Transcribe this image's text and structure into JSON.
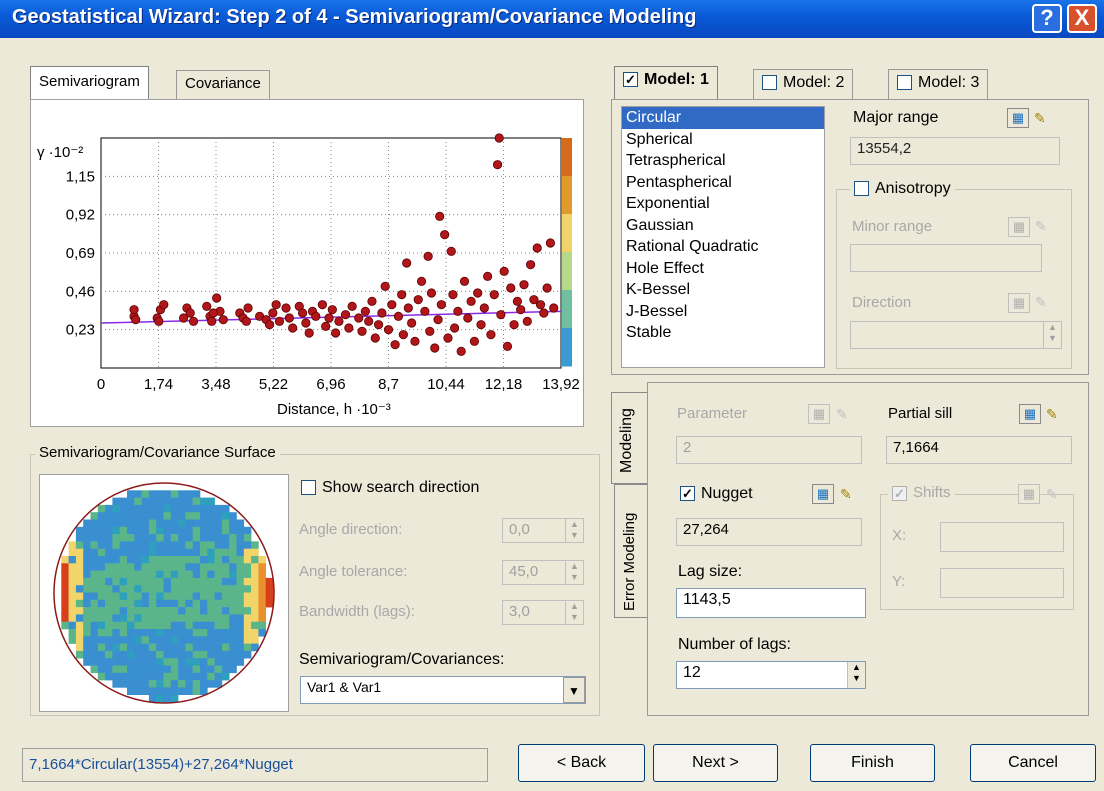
{
  "window": {
    "title": "Geostatistical Wizard: Step 2 of 4 - Semivariogram/Covariance Modeling",
    "help_label": "?",
    "close_label": "X"
  },
  "left_tabs": [
    "Semivariogram",
    "Covariance"
  ],
  "chart_data": {
    "type": "scatter",
    "ylabel": "γ ·10⁻²",
    "xlabel": "Distance, h ·10⁻³",
    "x_ticks": [
      "0",
      "1,74",
      "3,48",
      "5,22",
      "6,96",
      "8,7",
      "10,44",
      "12,18",
      "13,92"
    ],
    "y_ticks": [
      "0,23",
      "0,46",
      "0,69",
      "0,92",
      "1,15"
    ],
    "xlim": [
      0,
      13.92
    ],
    "ylim": [
      0,
      1.38
    ],
    "model_line": {
      "x": [
        0,
        13.92
      ],
      "y": [
        0.27,
        0.34
      ]
    },
    "legend_colors": [
      "#d46a1a",
      "#e39a2d",
      "#f2d36a",
      "#b7d98a",
      "#6fbfa0",
      "#3a9ad4"
    ],
    "points": [
      [
        1.0,
        0.31
      ],
      [
        1.0,
        0.35
      ],
      [
        1.05,
        0.29
      ],
      [
        1.7,
        0.3
      ],
      [
        1.8,
        0.35
      ],
      [
        1.9,
        0.38
      ],
      [
        1.75,
        0.28
      ],
      [
        2.5,
        0.3
      ],
      [
        2.6,
        0.36
      ],
      [
        2.7,
        0.33
      ],
      [
        2.8,
        0.28
      ],
      [
        3.2,
        0.37
      ],
      [
        3.3,
        0.31
      ],
      [
        3.35,
        0.28
      ],
      [
        3.5,
        0.42
      ],
      [
        3.6,
        0.34
      ],
      [
        3.7,
        0.29
      ],
      [
        3.4,
        0.33
      ],
      [
        4.2,
        0.33
      ],
      [
        4.3,
        0.3
      ],
      [
        4.4,
        0.28
      ],
      [
        4.45,
        0.36
      ],
      [
        4.8,
        0.31
      ],
      [
        5.0,
        0.29
      ],
      [
        5.1,
        0.26
      ],
      [
        5.2,
        0.33
      ],
      [
        5.3,
        0.38
      ],
      [
        5.4,
        0.28
      ],
      [
        5.6,
        0.36
      ],
      [
        5.7,
        0.3
      ],
      [
        5.8,
        0.24
      ],
      [
        6.0,
        0.37
      ],
      [
        6.1,
        0.33
      ],
      [
        6.2,
        0.27
      ],
      [
        6.3,
        0.21
      ],
      [
        6.4,
        0.34
      ],
      [
        6.5,
        0.31
      ],
      [
        6.7,
        0.38
      ],
      [
        6.8,
        0.25
      ],
      [
        6.9,
        0.3
      ],
      [
        7.0,
        0.35
      ],
      [
        7.1,
        0.21
      ],
      [
        7.2,
        0.28
      ],
      [
        7.4,
        0.32
      ],
      [
        7.5,
        0.24
      ],
      [
        7.6,
        0.37
      ],
      [
        7.8,
        0.3
      ],
      [
        7.9,
        0.22
      ],
      [
        8.0,
        0.34
      ],
      [
        8.1,
        0.28
      ],
      [
        8.2,
        0.4
      ],
      [
        8.3,
        0.18
      ],
      [
        8.4,
        0.26
      ],
      [
        8.5,
        0.33
      ],
      [
        8.6,
        0.49
      ],
      [
        8.7,
        0.23
      ],
      [
        8.8,
        0.38
      ],
      [
        8.9,
        0.14
      ],
      [
        9.0,
        0.31
      ],
      [
        9.1,
        0.44
      ],
      [
        9.15,
        0.2
      ],
      [
        9.25,
        0.63
      ],
      [
        9.3,
        0.36
      ],
      [
        9.4,
        0.27
      ],
      [
        9.5,
        0.16
      ],
      [
        9.6,
        0.41
      ],
      [
        9.7,
        0.52
      ],
      [
        9.8,
        0.34
      ],
      [
        9.9,
        0.67
      ],
      [
        9.95,
        0.22
      ],
      [
        10.0,
        0.45
      ],
      [
        10.1,
        0.12
      ],
      [
        10.2,
        0.29
      ],
      [
        10.25,
        0.91
      ],
      [
        10.3,
        0.38
      ],
      [
        10.4,
        0.8
      ],
      [
        10.5,
        0.18
      ],
      [
        10.6,
        0.7
      ],
      [
        10.65,
        0.44
      ],
      [
        10.7,
        0.24
      ],
      [
        10.8,
        0.34
      ],
      [
        10.9,
        0.1
      ],
      [
        11.0,
        0.52
      ],
      [
        11.1,
        0.3
      ],
      [
        11.2,
        0.4
      ],
      [
        11.3,
        0.16
      ],
      [
        11.4,
        0.45
      ],
      [
        11.5,
        0.26
      ],
      [
        11.6,
        0.36
      ],
      [
        11.7,
        0.55
      ],
      [
        11.8,
        0.2
      ],
      [
        11.9,
        0.44
      ],
      [
        12.0,
        1.22
      ],
      [
        12.05,
        1.38
      ],
      [
        12.1,
        0.32
      ],
      [
        12.2,
        0.58
      ],
      [
        12.3,
        0.13
      ],
      [
        12.4,
        0.48
      ],
      [
        12.5,
        0.26
      ],
      [
        12.6,
        0.4
      ],
      [
        12.7,
        0.35
      ],
      [
        12.8,
        0.5
      ],
      [
        12.9,
        0.28
      ],
      [
        13.0,
        0.62
      ],
      [
        13.1,
        0.41
      ],
      [
        13.2,
        0.72
      ],
      [
        13.3,
        0.38
      ],
      [
        13.4,
        0.33
      ],
      [
        13.5,
        0.48
      ],
      [
        13.6,
        0.75
      ],
      [
        13.7,
        0.36
      ]
    ]
  },
  "surface": {
    "group_label": "Semivariogram/Covariance Surface",
    "show_search_label": "Show search direction",
    "angle_direction_label": "Angle direction:",
    "angle_direction_value": "0,0",
    "angle_tolerance_label": "Angle tolerance:",
    "angle_tolerance_value": "45,0",
    "bandwidth_label": "Bandwidth (lags):",
    "bandwidth_value": "3,0",
    "semivar_cov_label": "Semivariogram/Covariances:",
    "semivar_cov_value": "Var1 & Var1"
  },
  "model_tabs": [
    {
      "label": "Model:",
      "num": "1",
      "checked": true
    },
    {
      "label": "Model:",
      "num": "2",
      "checked": false
    },
    {
      "label": "Model:",
      "num": "3",
      "checked": false
    }
  ],
  "models": [
    "Circular",
    "Spherical",
    "Tetraspherical",
    "Pentaspherical",
    "Exponential",
    "Gaussian",
    "Rational Quadratic",
    "Hole Effect",
    "K-Bessel",
    "J-Bessel",
    "Stable"
  ],
  "selected_model": "Circular",
  "major_range": {
    "label": "Major range",
    "value": "13554,2"
  },
  "anisotropy_label": "Anisotropy",
  "minor_range_label": "Minor range",
  "direction_label": "Direction",
  "side_tabs": [
    "Modeling",
    "Error Modeling"
  ],
  "parameter": {
    "label": "Parameter",
    "value": "2"
  },
  "partial_sill": {
    "label": "Partial sill",
    "value": "7,1664"
  },
  "nugget": {
    "label": "Nugget",
    "value": "27,264"
  },
  "shifts": {
    "label": "Shifts",
    "x_label": "X:",
    "y_label": "Y:"
  },
  "lag_size": {
    "label": "Lag size:",
    "value": "1143,5"
  },
  "num_lags": {
    "label": "Number of lags:",
    "value": "12"
  },
  "formula": "7,1664*Circular(13554)+27,264*Nugget",
  "buttons": {
    "back": "< Back",
    "next": "Next >",
    "finish": "Finish",
    "cancel": "Cancel"
  },
  "check_mark": "✓",
  "icons": {
    "calc": "▦",
    "pencil": "✎",
    "combo_arrow": "▼",
    "spin_up": "▲",
    "spin_down": "▼"
  }
}
